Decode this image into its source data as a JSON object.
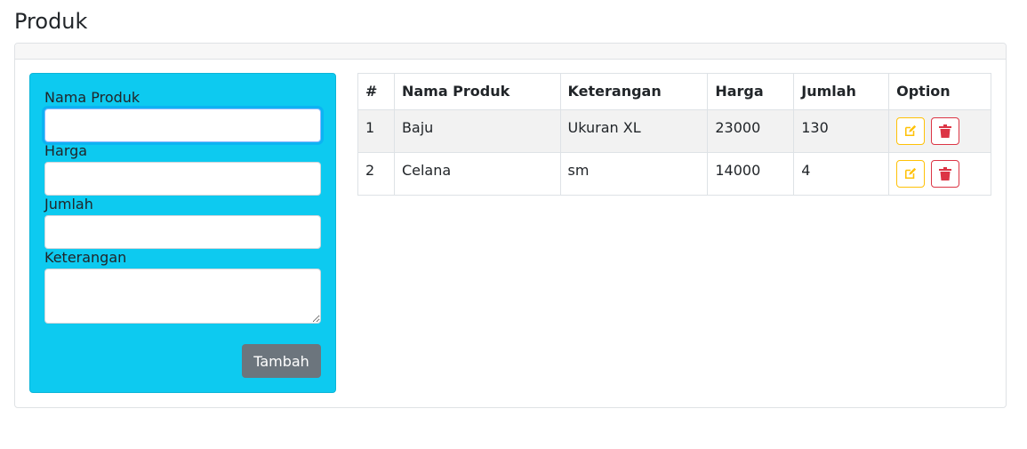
{
  "page": {
    "title": "Produk"
  },
  "form": {
    "nama_label": "Nama Produk",
    "nama_value": "",
    "harga_label": "Harga",
    "harga_value": "",
    "jumlah_label": "Jumlah",
    "jumlah_value": "",
    "keterangan_label": "Keterangan",
    "keterangan_value": "",
    "submit_label": "Tambah"
  },
  "table": {
    "headers": [
      "#",
      "Nama Produk",
      "Keterangan",
      "Harga",
      "Jumlah",
      "Option"
    ],
    "rows": [
      {
        "no": "1",
        "nama": "Baju",
        "keterangan": "Ukuran XL",
        "harga": "23000",
        "jumlah": "130"
      },
      {
        "no": "2",
        "nama": "Celana",
        "keterangan": "sm",
        "harga": "14000",
        "jumlah": "4"
      }
    ]
  },
  "icons": {
    "edit": "edit-icon",
    "delete": "trash-icon"
  },
  "colors": {
    "form_panel": "#0dcaf0",
    "submit_button": "#6c757d",
    "edit_accent": "#ffc107",
    "delete_accent": "#dc3545"
  }
}
